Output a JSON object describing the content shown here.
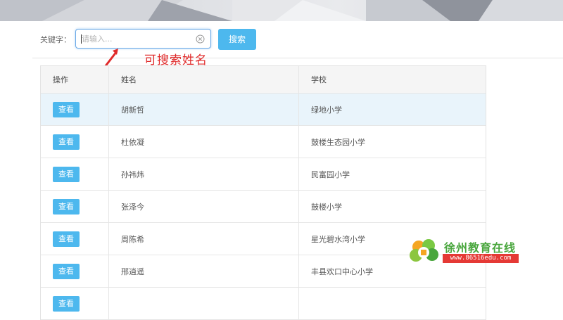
{
  "search": {
    "label": "关键字：",
    "placeholder": "请输入...",
    "value": "",
    "button_label": "搜索"
  },
  "annotation": {
    "text": "可搜索姓名"
  },
  "table": {
    "columns": [
      "操作",
      "姓名",
      "学校"
    ],
    "rows": [
      {
        "action": "查看",
        "name": "胡新哲",
        "school": "绿地小学"
      },
      {
        "action": "查看",
        "name": "杜依凝",
        "school": "鼓楼生态园小学"
      },
      {
        "action": "查看",
        "name": "孙祎炜",
        "school": "民富园小学"
      },
      {
        "action": "查看",
        "name": "张泽今",
        "school": "鼓楼小学"
      },
      {
        "action": "查看",
        "name": "周陈希",
        "school": "星光碧水湾小学"
      },
      {
        "action": "查看",
        "name": "邢逍遥",
        "school": "丰县欢口中心小学"
      },
      {
        "action": "查看",
        "name": "",
        "school": ""
      }
    ]
  },
  "watermark": {
    "title": "徐州教育在线",
    "url": "www.86516edu.com"
  },
  "colors": {
    "accent": "#4db8ee",
    "annotation": "#e02a2a",
    "brand": "#49a63d"
  }
}
